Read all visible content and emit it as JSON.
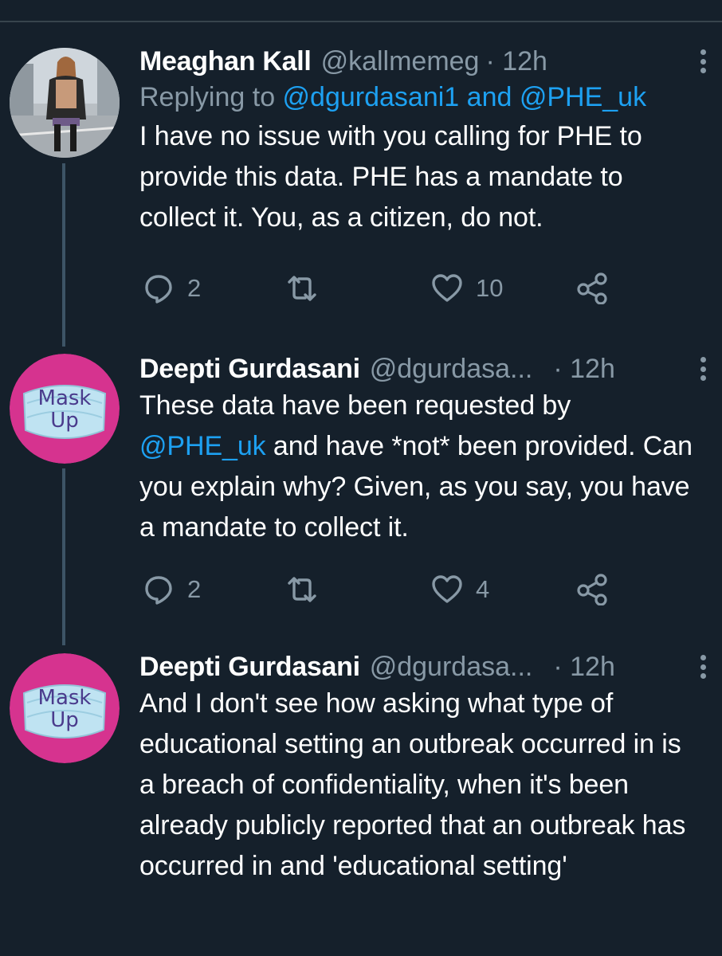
{
  "tweets": [
    {
      "name": "Meaghan Kall",
      "handle": "@kallmemeg",
      "time": "· 12h",
      "reply_prefix": "Replying to ",
      "reply_user1": "@dgurdasani1",
      "reply_and": " and ",
      "reply_user2": "@PHE_uk",
      "text": "I have no issue with you calling for PHE to provide this data. PHE has a mandate to collect it. You, as a citizen, do not.",
      "replies": "2",
      "retweets": "",
      "likes": "10"
    },
    {
      "name": "Deepti Gurdasani",
      "handle": "@dgurdasa...",
      "time": "· 12h",
      "avatar_line1": "Mask",
      "avatar_line2": "Up",
      "text_part1": "These data have been requested by ",
      "mention": "@PHE_uk",
      "text_part2": " and have *not* been provided. Can you explain why? Given, as you say, you have a mandate to collect it.",
      "replies": "2",
      "retweets": "",
      "likes": "4"
    },
    {
      "name": "Deepti Gurdasani",
      "handle": "@dgurdasa...",
      "time": "· 12h",
      "avatar_line1": "Mask",
      "avatar_line2": "Up",
      "text": "And I don't see how asking what type of educational setting an outbreak occurred in is a breach of confidentiality, when it's been already publicly reported that an outbreak has occurred in and 'educational setting'"
    }
  ],
  "colors": {
    "background": "#15202b",
    "secondary_text": "#8899a6",
    "link": "#1da1f2",
    "thread_line": "#3d5466",
    "mask_pink": "#d6338f",
    "mask_text": "#4a3b8c"
  },
  "icons": [
    "reply-icon",
    "retweet-icon",
    "like-icon",
    "share-icon",
    "more-icon"
  ]
}
